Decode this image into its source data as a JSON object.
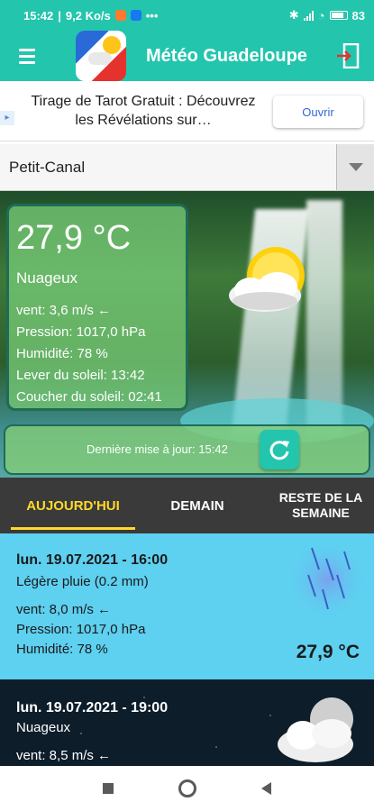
{
  "status_bar": {
    "time": "15:42",
    "speed": "9,2 Ko/s",
    "more": "•••",
    "battery": "83"
  },
  "app_bar": {
    "title": "Météo Guadeloupe"
  },
  "ad": {
    "text": "Tirage de Tarot Gratuit : Découvrez les Révélations sur…",
    "cta": "Ouvrir"
  },
  "location": {
    "selected": "Petit-Canal"
  },
  "current": {
    "temperature": "27,9 °C",
    "condition": "Nuageux",
    "wind": "vent: 3,6 m/s ←",
    "pressure": "Pression: 1017,0 hPa",
    "humidity": "Humidité: 78 %",
    "sunrise": "Lever du soleil: 13:42",
    "sunset": "Coucher du soleil: 02:41",
    "last_update": "Dernière mise à jour: 15:42"
  },
  "tabs": [
    {
      "label": "AUJOURD'HUI",
      "active": true
    },
    {
      "label": "DEMAIN",
      "active": false
    },
    {
      "label": "RESTE DE LA SEMAINE",
      "active": false
    }
  ],
  "forecast": [
    {
      "datetime": "lun. 19.07.2021 - 16:00",
      "condition": "Légère pluie (0.2 mm)",
      "wind": "vent: 8,0 m/s ←",
      "pressure": "Pression: 1017,0 hPa",
      "humidity": "Humidité: 78 %",
      "temperature": "27,9 °C",
      "icon": "rain-icon"
    },
    {
      "datetime": "lun. 19.07.2021 - 19:00",
      "condition": "Nuageux",
      "wind": "vent: 8,5 m/s ←",
      "icon": "cloudy-night-icon"
    }
  ],
  "colors": {
    "accent": "#23c5ad",
    "tab_active": "#ffd92b",
    "tab_bar": "#3a3a3a",
    "day_card": "#5ed0f0",
    "night_card": "#0d1d2a"
  }
}
